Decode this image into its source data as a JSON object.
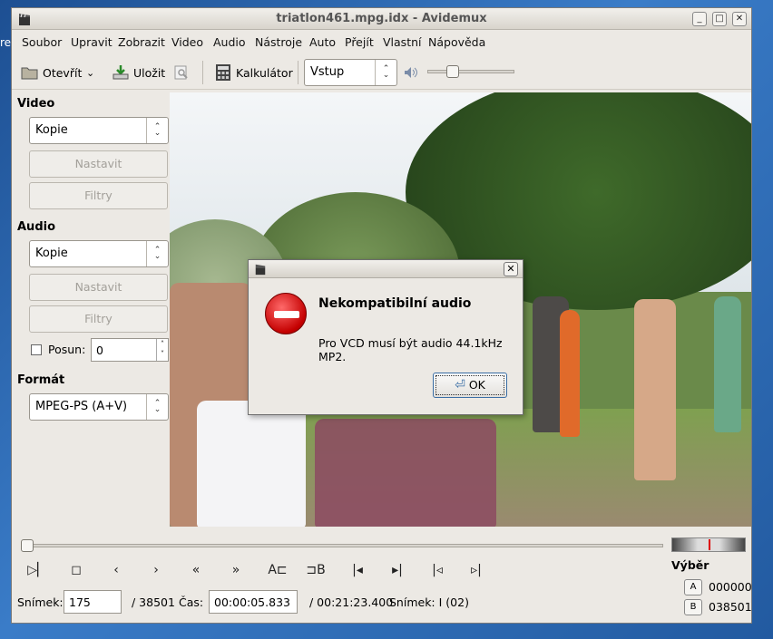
{
  "window": {
    "title": "triatlon461.mpg.idx - Avidemux"
  },
  "desktop": {
    "edge_text": "re"
  },
  "menu": [
    "Soubor",
    "Upravit",
    "Zobrazit",
    "Video",
    "Audio",
    "Nástroje",
    "Auto",
    "Přejít",
    "Vlastní",
    "Nápověda"
  ],
  "toolbar": {
    "open": "Otevřít",
    "save": "Uložit",
    "calculator": "Kalkulátor",
    "view_mode": "Vstup",
    "volume": 0.25
  },
  "left": {
    "video_label": "Video",
    "video_codec": "Kopie",
    "video_configure": "Nastavit",
    "video_filters": "Filtry",
    "audio_label": "Audio",
    "audio_codec": "Kopie",
    "audio_configure": "Nastavit",
    "audio_filters": "Filtry",
    "shift_label": "Posun:",
    "shift_value": "0",
    "format_label": "Formát",
    "format_value": "MPEG-PS (A+V)"
  },
  "dialog": {
    "heading": "Nekompatibilní audio",
    "message": "Pro VCD musí být audio 44.1kHz MP2.",
    "ok": "OK"
  },
  "controls": {
    "mark_a": "A",
    "mark_b": "B",
    "selection_label": "Výběr",
    "a_value": "000000",
    "b_value": "038501",
    "a_btn": "A",
    "b_btn": "B"
  },
  "status": {
    "frame_label": "Snímek:",
    "frame_value": "175",
    "frame_total": "/ 38501",
    "time_label": "Čas:",
    "time_value": "00:00:05.833",
    "time_total": "/ 00:21:23.400",
    "frame_type": "Snímek: I (02)"
  },
  "colors": {
    "accent": "#3a6ea5",
    "error": "#c40000"
  }
}
